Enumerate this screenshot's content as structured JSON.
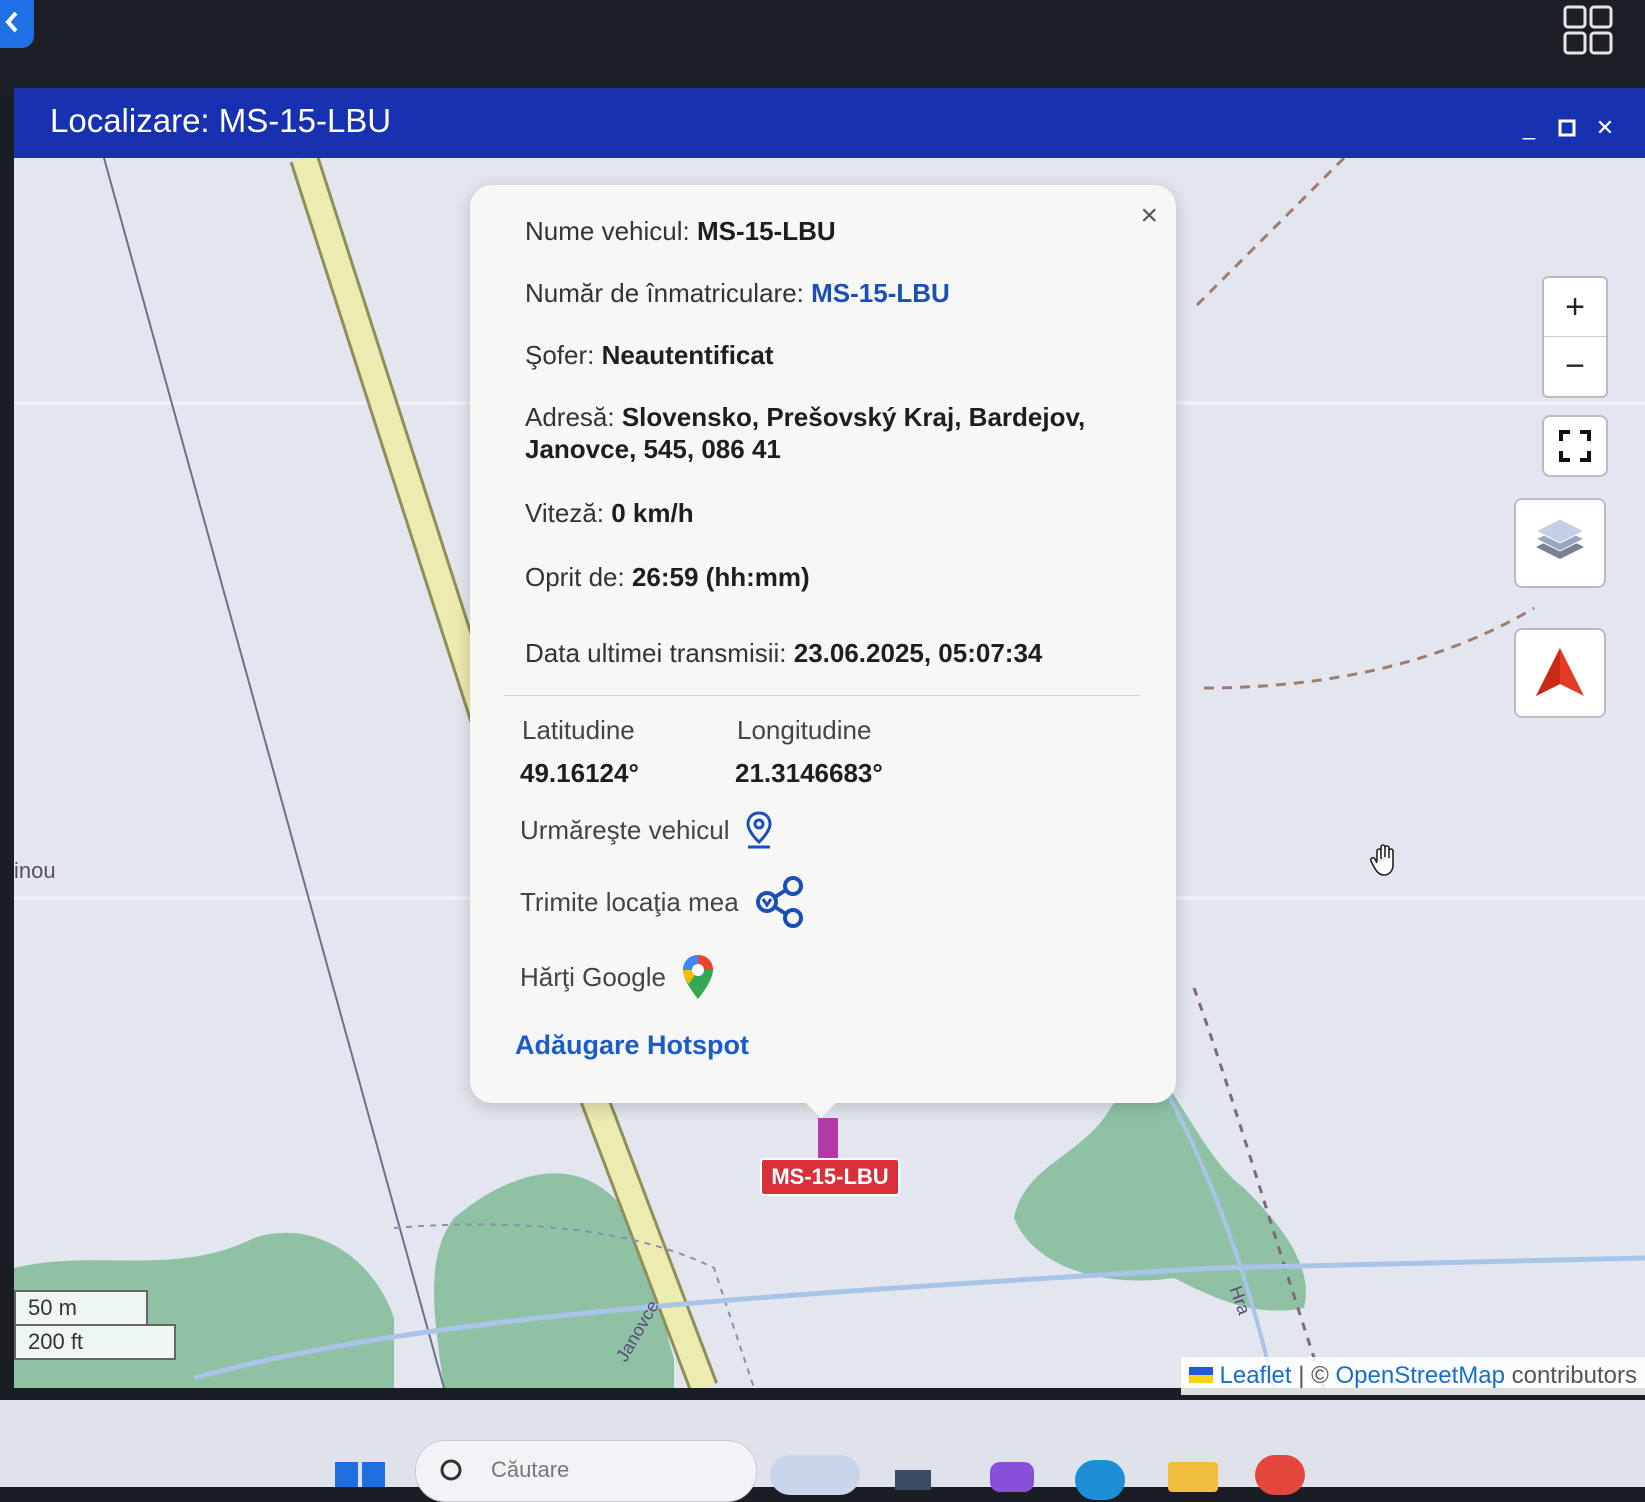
{
  "window": {
    "title": "Localizare: MS-15-LBU"
  },
  "map": {
    "place_label": "inou",
    "road_label": "Janovce",
    "road_label_right": "Hra",
    "controls": {
      "zoom_in": "+",
      "zoom_out": "−"
    },
    "marker_label": "MS-15-LBU",
    "scale": {
      "metric": "50 m",
      "imperial": "200 ft"
    },
    "attribution": {
      "leaflet": "Leaflet",
      "separator": " | © ",
      "osm": "OpenStreetMap",
      "contributors": " contributors"
    }
  },
  "popup": {
    "close_label": "×",
    "vehicle_name_label": "Nume vehicul: ",
    "vehicle_name": "MS-15-LBU",
    "registration_label": "Număr de înmatriculare: ",
    "registration": "MS-15-LBU",
    "driver_label": "Şofer: ",
    "driver": "Neautentificat",
    "address_label": "Adresă: ",
    "address": "Slovensko, Prešovský Kraj, Bardejov, Janovce, 545, 086 41",
    "speed_label": "Viteză: ",
    "speed": "0 km/h",
    "stopped_label": "Oprit de: ",
    "stopped": "26:59 (hh:mm)",
    "last_transmission_label": "Data ultimei transmisii: ",
    "last_transmission": "23.06.2025, 05:07:34",
    "latitude_label": "Latitudine",
    "latitude": "49.16124°",
    "longitude_label": "Longitudine",
    "longitude": "21.3146683°",
    "follow_vehicle": "Urmăreşte vehicul",
    "send_location": "Trimite locaţia mea",
    "google_maps": "Hărţi Google",
    "add_hotspot": "Adăugare Hotspot"
  },
  "taskbar": {
    "search_placeholder": "Căutare"
  },
  "colors": {
    "titlebar": "#1831b0",
    "link_blue": "#1a4fb8",
    "marker_red": "#d92f3a",
    "marker_stem": "#b23aa8",
    "forest": "#8fc2a5"
  }
}
